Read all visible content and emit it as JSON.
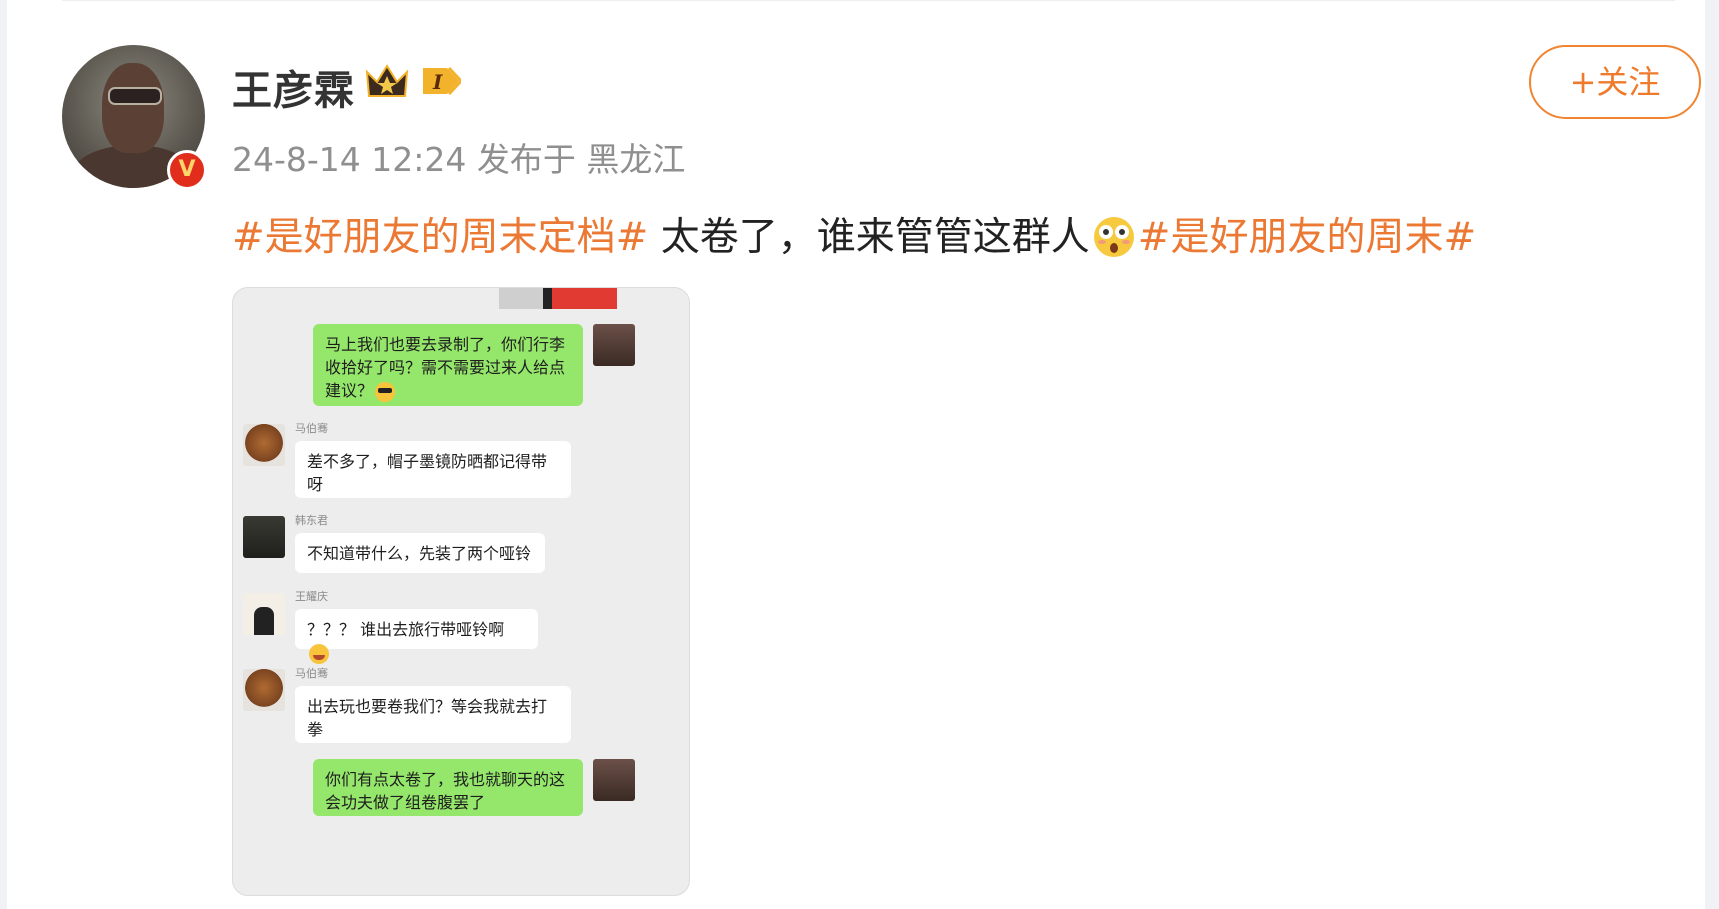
{
  "post": {
    "author": "王彦霖",
    "vip_level": "I",
    "timestamp": "24-8-14 12:24",
    "location_prefix": "发布于",
    "location": "黑龙江",
    "follow_label": "+关注",
    "tag1": "#是好朋友的周末定档#",
    "body_text": " 太卷了，谁来管管这群人",
    "tag2": "#是好朋友的周末#",
    "verified_badge": "V"
  },
  "chat": {
    "messages": [
      {
        "sender": "",
        "side": "right",
        "text": "马上我们也要去录制了，你们行李收拾好了吗？需不需要过来人给点建议？"
      },
      {
        "sender": "马伯骞",
        "side": "left",
        "text": "差不多了，帽子墨镜防晒都记得带呀"
      },
      {
        "sender": "韩东君",
        "side": "left",
        "text": "不知道带什么，先装了两个哑铃"
      },
      {
        "sender": "王耀庆",
        "side": "left",
        "text": "？？？ 谁出去旅行带哑铃啊"
      },
      {
        "sender": "马伯骞",
        "side": "left",
        "text": "出去玩也要卷我们？等会我就去打拳"
      },
      {
        "sender": "",
        "side": "right",
        "text": "你们有点太卷了，我也就聊天的这会功夫做了组卷腹罢了"
      }
    ]
  },
  "colors": {
    "accent": "#eb7833",
    "bubble_out": "#95e76b",
    "bubble_in": "#ffffff",
    "badge_red": "#e02d1c"
  },
  "icons": {
    "verified": "verified-v-icon",
    "vip": "crown-vip-icon",
    "emoji_post": "astonished-face-icon",
    "emoji_cool": "sunglasses-face-icon",
    "emoji_laugh": "rolling-laugh-face-icon"
  }
}
